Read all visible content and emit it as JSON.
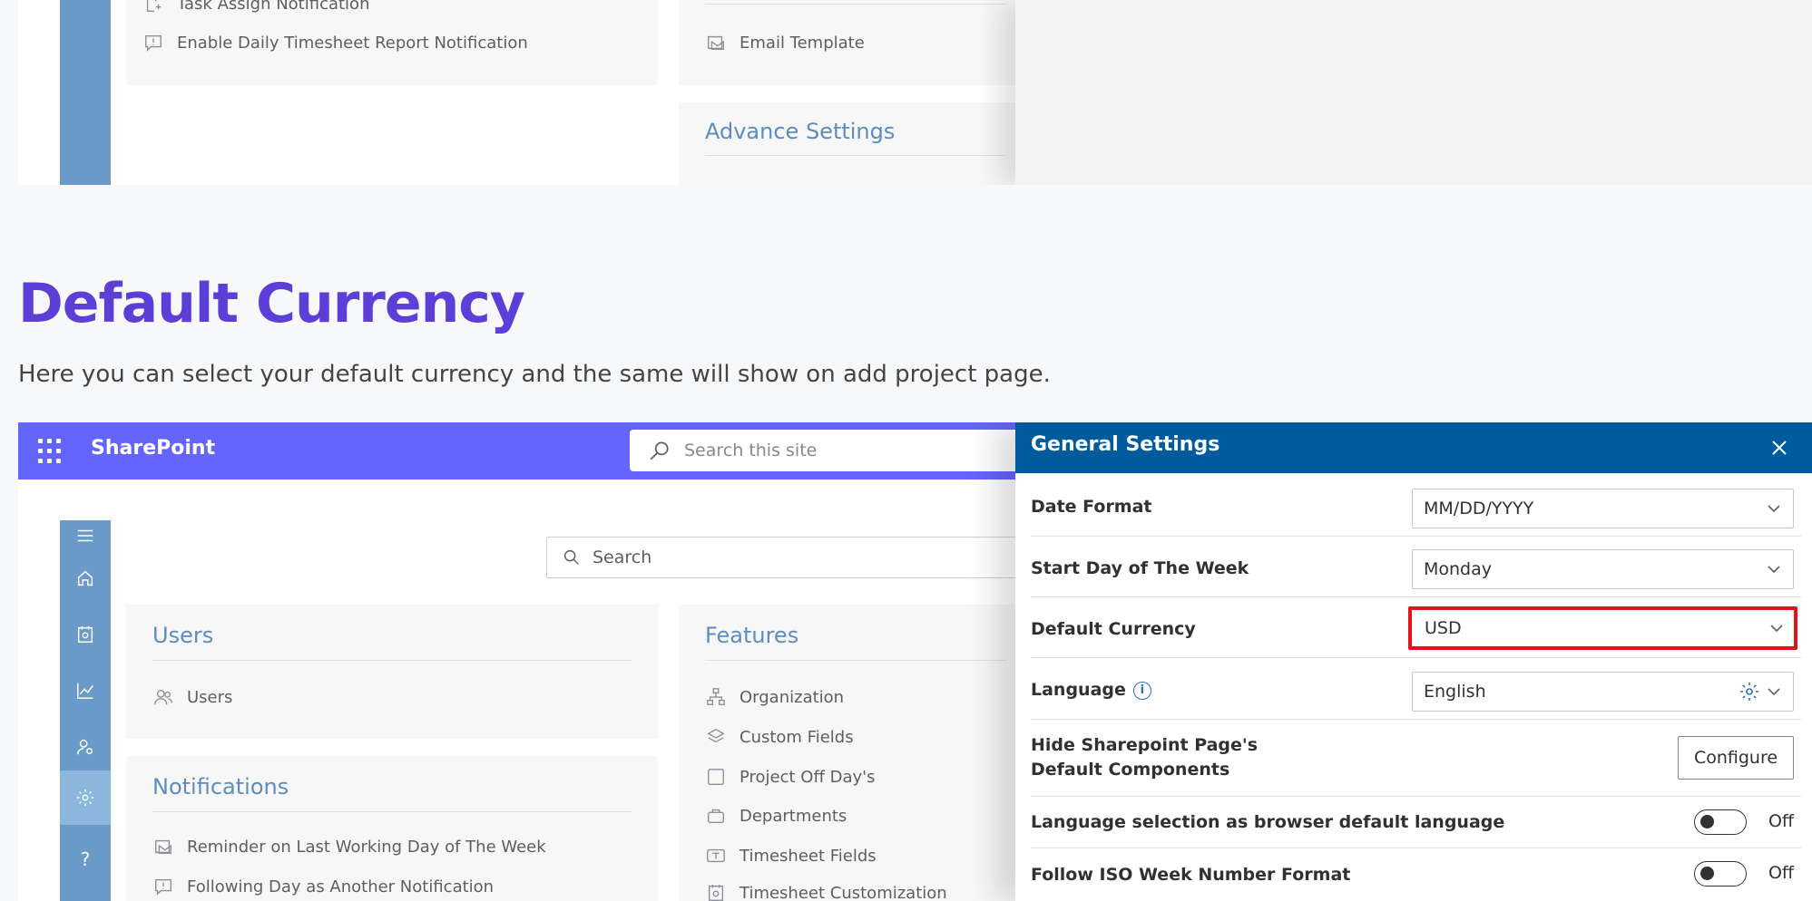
{
  "top_screenshot": {
    "notifications_items": [
      {
        "label": "Task Assign Notification",
        "icon": "task-assign-icon"
      },
      {
        "label": "Enable Daily Timesheet Report Notification",
        "icon": "alert-message-icon"
      }
    ],
    "features_items": [
      {
        "label": "Email Template",
        "icon": "email-template-icon"
      }
    ],
    "advance_settings_title": "Advance Settings"
  },
  "section": {
    "title": "Default Currency",
    "description": "Here you can select your default currency and the same will show on add project page."
  },
  "sharepoint": {
    "app_name": "SharePoint",
    "search_placeholder": "Search this site",
    "brand_color": "#6464ff"
  },
  "app": {
    "search_placeholder": "Search",
    "rail_icons": [
      "menu-icon",
      "home-icon",
      "timesheet-icon",
      "chart-icon",
      "user-settings-icon",
      "gear-icon",
      "help-icon"
    ],
    "help_glyph": "?",
    "users_card": {
      "title": "Users",
      "items": [
        {
          "label": "Users",
          "icon": "users-icon"
        }
      ]
    },
    "notifications_card": {
      "title": "Notifications",
      "items": [
        {
          "label": "Reminder on Last Working Day of The Week",
          "icon": "email-template-icon"
        },
        {
          "label": "Following Day as Another Notification",
          "icon": "alert-message-icon"
        }
      ]
    },
    "features_card": {
      "title": "Features",
      "items": [
        {
          "label": "Organization",
          "icon": "org-chart-icon"
        },
        {
          "label": "Custom Fields",
          "icon": "layers-icon"
        },
        {
          "label": "Project Off Day's",
          "icon": "square-icon"
        },
        {
          "label": "Departments",
          "icon": "briefcase-icon"
        },
        {
          "label": "Timesheet Fields",
          "icon": "text-field-icon"
        },
        {
          "label": "Timesheet Customization",
          "icon": "timesheet-icon"
        }
      ]
    }
  },
  "general_settings": {
    "title": "General Settings",
    "header_color": "#005a9e",
    "highlight_color": "#e8101b",
    "date_format": {
      "label": "Date Format",
      "value": "MM/DD/YYYY"
    },
    "start_day": {
      "label": "Start Day of The Week",
      "value": "Monday"
    },
    "default_currency": {
      "label": "Default Currency",
      "value": "USD"
    },
    "language": {
      "label": "Language",
      "value": "English",
      "info_glyph": "i"
    },
    "hide_components": {
      "label": "Hide Sharepoint Page's Default Components",
      "button": "Configure"
    },
    "language_browser_default": {
      "label": "Language selection as browser default language",
      "state": "Off"
    },
    "iso_week": {
      "label": "Follow ISO Week Number Format",
      "state": "Off"
    }
  }
}
